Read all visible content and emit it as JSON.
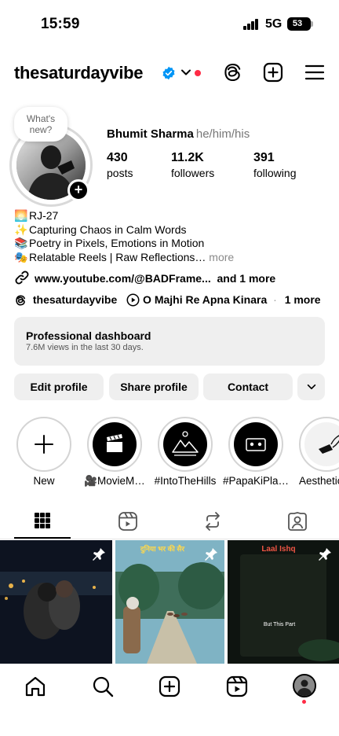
{
  "status": {
    "time": "15:59",
    "network": "5G",
    "battery": "53"
  },
  "header": {
    "username": "thesaturdayvibe"
  },
  "profile": {
    "note": "What's new?",
    "name": "Bhumit Sharma",
    "pronouns": "he/him/his",
    "stats": [
      {
        "value": "430",
        "label": "posts"
      },
      {
        "value": "11.2K",
        "label": "followers"
      },
      {
        "value": "391",
        "label": "following"
      }
    ]
  },
  "bio": {
    "lines": [
      {
        "emoji": "🌅",
        "text": "RJ-27"
      },
      {
        "emoji": "✨",
        "text": "Capturing Chaos in Calm Words"
      },
      {
        "emoji": "📚",
        "text": "Poetry in Pixels, Emotions in Motion"
      },
      {
        "emoji": "🎭",
        "text": "Relatable Reels | Raw Reflections…"
      }
    ],
    "more": "more",
    "link": "www.youtube.com/@BADFrame...",
    "link_more": "and 1 more",
    "threads_handle": "thesaturdayvibe",
    "music": "O Majhi Re Apna Kinara",
    "music_sep": "·",
    "music_more": "1 more"
  },
  "dashboard": {
    "title": "Professional dashboard",
    "subtitle": "7.6M views in the last 30 days."
  },
  "buttons": {
    "edit": "Edit profile",
    "share": "Share profile",
    "contact": "Contact"
  },
  "highlights": [
    {
      "label": "New"
    },
    {
      "label": "🎥MovieM…"
    },
    {
      "label": "#IntoTheHills"
    },
    {
      "label": "#PapaKiPla…"
    },
    {
      "label": "Aesthetic"
    }
  ],
  "posts": [
    {
      "caption": ""
    },
    {
      "caption": "दुनिया भर की सैर"
    },
    {
      "title": "Laal Ishq",
      "caption": "But This Part"
    }
  ],
  "colors": {
    "accent": "#0095f6",
    "notification": "#ff2b45",
    "surface": "#efefef"
  }
}
